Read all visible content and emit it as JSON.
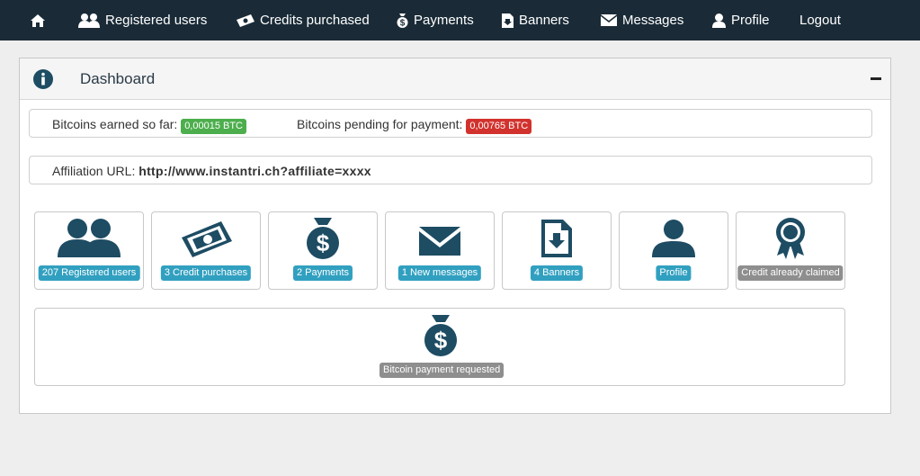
{
  "nav": {
    "home_icon": "home-icon",
    "items": [
      {
        "label": "Registered users",
        "icon": "users-icon"
      },
      {
        "label": "Credits purchased",
        "icon": "money-icon"
      },
      {
        "label": "Payments",
        "icon": "money-bag-icon"
      },
      {
        "label": "Banners",
        "icon": "file-download-icon"
      },
      {
        "label": "Messages",
        "icon": "envelope-icon"
      },
      {
        "label": "Profile",
        "icon": "user-icon"
      },
      {
        "label": "Logout",
        "icon": ""
      }
    ]
  },
  "panel": {
    "title": "Dashboard",
    "icon": "info-icon"
  },
  "earnings": {
    "earned_label": "Bitcoins earned so far:",
    "earned_value": "0,00015 BTC",
    "pending_label": "Bitcoins pending for payment:",
    "pending_value": "0,00765 BTC"
  },
  "affiliation": {
    "label": "Affiliation URL:",
    "url": "http://www.instantri.ch?affiliate=xxxx"
  },
  "tiles": [
    {
      "label": "207 Registered users",
      "icon": "users-icon",
      "badge_color": "#31a0c0"
    },
    {
      "label": "3 Credit purchases",
      "icon": "money-icon",
      "badge_color": "#31a0c0"
    },
    {
      "label": "2 Payments",
      "icon": "money-bag-icon",
      "badge_color": "#31a0c0"
    },
    {
      "label": "1 New messages",
      "icon": "envelope-icon",
      "badge_color": "#31a0c0"
    },
    {
      "label": "4 Banners",
      "icon": "file-download-icon",
      "badge_color": "#31a0c0"
    },
    {
      "label": "Profile",
      "icon": "user-icon",
      "badge_color": "#31a0c0"
    },
    {
      "label": "Credit already claimed",
      "icon": "award-icon",
      "badge_color": "#8e8e8e"
    }
  ],
  "payment_request": {
    "label": "Bitcoin payment requested",
    "icon": "money-bag-icon"
  },
  "colors": {
    "navbar": "#1a2b37",
    "icon": "#1d4c63",
    "success": "#4cae4c",
    "danger": "#d2322d",
    "info": "#31a0c0",
    "muted": "#8e8e8e"
  }
}
